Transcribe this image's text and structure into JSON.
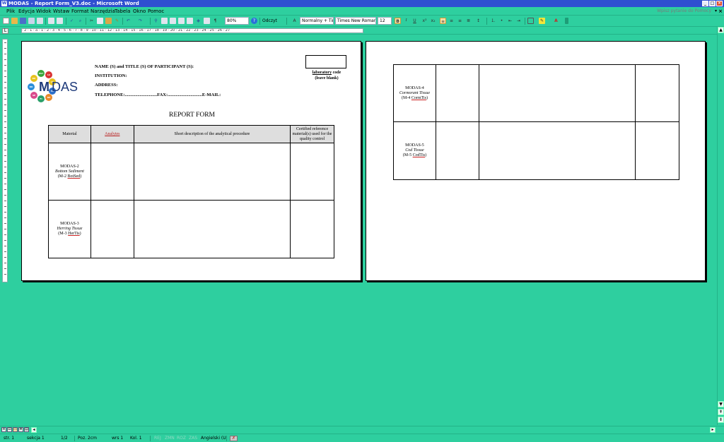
{
  "window": {
    "title": "MODAS - Report Form_V3.doc - Microsoft Word",
    "buttons": [
      "_",
      "□",
      "×"
    ]
  },
  "menu": {
    "items": [
      "Plik",
      "Edycja",
      "Widok",
      "Wstaw",
      "Format",
      "Narzędzia",
      "Tabela",
      "Okno",
      "Pomoc"
    ],
    "help_placeholder": "Wpisz pytanie do Pomocy",
    "close_doc": "×"
  },
  "toolbar": {
    "zoom": "80%",
    "read_label": "Odczyt",
    "style": "Normalny + Tin",
    "font": "Times New Roman",
    "size": "12",
    "bold": "B",
    "italic": "I",
    "underline": "U"
  },
  "ruler": {
    "corner": "L",
    "numbers": "· 2 · 1 · ⌂ · 1 · 2 · 3 · 4 · 5 · 6 · 7 · 8 · 9 · 10 · 11 · 12 · 13 · 14 · 15 · 16 · 17 · 18 · 19 · 20 · 21 · 22 · 23 · 24 · 25 · 26 · 27"
  },
  "logo": {
    "m": "M",
    "das": "DAS",
    "dots": [
      {
        "label": "EST",
        "color": "#3aa53a"
      },
      {
        "label": "LV",
        "color": "#d93434"
      },
      {
        "label": "LT",
        "color": "#e6c21e"
      },
      {
        "label": "PL",
        "color": "#2c6fc9"
      },
      {
        "label": "DE",
        "color": "#e8892a"
      },
      {
        "label": "FI",
        "color": "#2aa06a"
      },
      {
        "label": "SE",
        "color": "#d94a8c"
      },
      {
        "label": "DK",
        "color": "#2c8fd9"
      },
      {
        "label": "RU",
        "color": "#e6c21e"
      }
    ]
  },
  "form": {
    "name_label": "NAME (S) and TITLE (S) OF PARTICIPANT (S):",
    "institution_label": "INSTITUTION:",
    "address_label": "ADDRESS:",
    "contact_line": "TELEPHONE:............................FAX:..............................E-MAIL:",
    "lab_code_line1": "laboratory",
    "lab_code_line1b": " code",
    "lab_code_line2": "(leave blank)",
    "title": "REPORT FORM"
  },
  "table": {
    "headers": [
      "Material",
      "Analytes",
      "Short description of the analytical procedure",
      "Certified reference material(s) used for the quality control"
    ],
    "rows_page1": [
      {
        "name": "MODAS-2",
        "latin": "Bottom Sediment",
        "code_pre": "(M-2 ",
        "code_u": "BotSed",
        "code_post": ")"
      },
      {
        "name": "MODAS-3",
        "latin": "Herring Tissue",
        "code_pre": "(M-3 ",
        "code_u": "HerTis",
        "code_post": ")"
      }
    ],
    "rows_page2": [
      {
        "name": "MODAS-4",
        "latin": "Cormorant Tissue",
        "code_pre": "(M-4 ",
        "code_u": "CormTis",
        "code_post": ")"
      },
      {
        "name": "MODAS-5",
        "latin": "Cod Tissue",
        "code_pre": "(M-5 ",
        "code_u": "CodTis",
        "code_post": ")"
      }
    ]
  },
  "status": {
    "page": "str. 1",
    "section": "sekcja 1",
    "pages": "1/2",
    "position": "Poz.  2cm",
    "line": "wrs  1",
    "column": "Kol.  1",
    "rej": "REJ",
    "zmn": "ZMN",
    "roz": "ROZ",
    "zas": "ZAS",
    "language": "Angielski (U"
  }
}
